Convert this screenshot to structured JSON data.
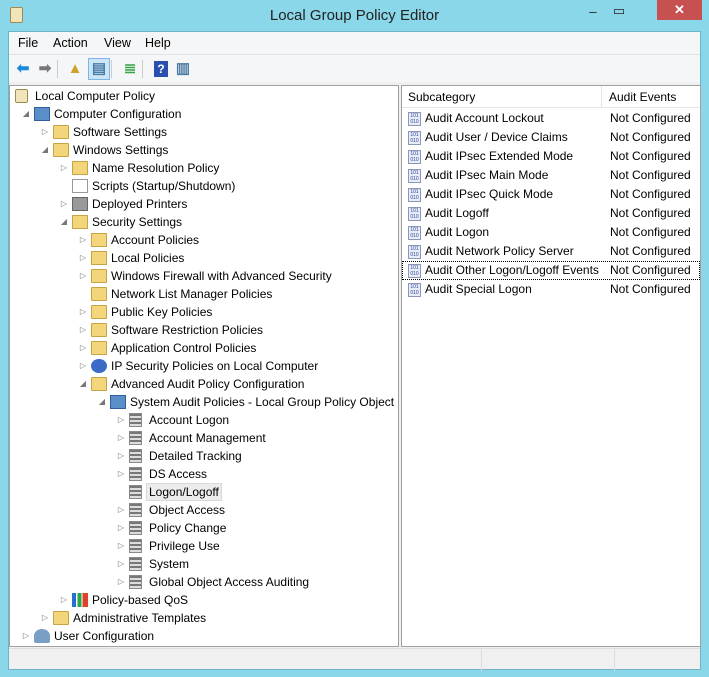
{
  "window": {
    "title": "Local Group Policy Editor",
    "minimize": "–",
    "maximize": "▭",
    "close": "✕"
  },
  "menu": [
    "File",
    "Action",
    "View",
    "Help"
  ],
  "toolbar": [
    {
      "name": "back-button",
      "glyph": "⬅",
      "color": "#1e88d8"
    },
    {
      "name": "forward-button",
      "glyph": "➡",
      "color": "#777"
    },
    {
      "name": "up-folder-button",
      "glyph": "▲",
      "color": "#d1a12d"
    },
    {
      "name": "show-hide-tree-button",
      "glyph": "▤",
      "color": "#4a7ba6",
      "active": true
    },
    {
      "name": "export-list-button",
      "glyph": "≣",
      "color": "#3aa34a"
    },
    {
      "name": "help-button",
      "glyph": "?",
      "color": "#fff",
      "bg": "#2a4fb0"
    },
    {
      "name": "show-hide-action-pane-button",
      "glyph": "▥",
      "color": "#4a7ba6"
    }
  ],
  "tree": [
    {
      "label": "Local Computer Policy",
      "level": 0,
      "exp": "none",
      "icon": "scroll"
    },
    {
      "label": "Computer Configuration",
      "level": 1,
      "exp": "open",
      "icon": "computer"
    },
    {
      "label": "Software Settings",
      "level": 2,
      "exp": "closed",
      "icon": "folder"
    },
    {
      "label": "Windows Settings",
      "level": 2,
      "exp": "open",
      "icon": "folder"
    },
    {
      "label": "Name Resolution Policy",
      "level": 3,
      "exp": "closed",
      "icon": "folder"
    },
    {
      "label": "Scripts (Startup/Shutdown)",
      "level": 3,
      "exp": "none",
      "icon": "script"
    },
    {
      "label": "Deployed Printers",
      "level": 3,
      "exp": "closed",
      "icon": "printer"
    },
    {
      "label": "Security Settings",
      "level": 3,
      "exp": "open",
      "icon": "lock"
    },
    {
      "label": "Account Policies",
      "level": 4,
      "exp": "closed",
      "icon": "lock"
    },
    {
      "label": "Local Policies",
      "level": 4,
      "exp": "closed",
      "icon": "lock"
    },
    {
      "label": "Windows Firewall with Advanced Security",
      "level": 4,
      "exp": "closed",
      "icon": "folder"
    },
    {
      "label": "Network List Manager Policies",
      "level": 4,
      "exp": "none",
      "icon": "folder"
    },
    {
      "label": "Public Key Policies",
      "level": 4,
      "exp": "closed",
      "icon": "folder"
    },
    {
      "label": "Software Restriction Policies",
      "level": 4,
      "exp": "closed",
      "icon": "folder"
    },
    {
      "label": "Application Control Policies",
      "level": 4,
      "exp": "closed",
      "icon": "folder"
    },
    {
      "label": "IP Security Policies on Local Computer",
      "level": 4,
      "exp": "closed",
      "icon": "ipsec"
    },
    {
      "label": "Advanced Audit Policy Configuration",
      "level": 4,
      "exp": "open",
      "icon": "folder"
    },
    {
      "label": "System Audit Policies - Local Group Policy Object",
      "level": 5,
      "exp": "open",
      "icon": "computer"
    },
    {
      "label": "Account Logon",
      "level": 6,
      "exp": "closed",
      "icon": "audit"
    },
    {
      "label": "Account Management",
      "level": 6,
      "exp": "closed",
      "icon": "audit"
    },
    {
      "label": "Detailed Tracking",
      "level": 6,
      "exp": "closed",
      "icon": "audit"
    },
    {
      "label": "DS Access",
      "level": 6,
      "exp": "closed",
      "icon": "audit"
    },
    {
      "label": "Logon/Logoff",
      "level": 6,
      "exp": "none",
      "icon": "audit",
      "selected": true
    },
    {
      "label": "Object Access",
      "level": 6,
      "exp": "closed",
      "icon": "audit"
    },
    {
      "label": "Policy Change",
      "level": 6,
      "exp": "closed",
      "icon": "audit"
    },
    {
      "label": "Privilege Use",
      "level": 6,
      "exp": "closed",
      "icon": "audit"
    },
    {
      "label": "System",
      "level": 6,
      "exp": "closed",
      "icon": "audit"
    },
    {
      "label": "Global Object Access Auditing",
      "level": 6,
      "exp": "closed",
      "icon": "audit"
    },
    {
      "label": "Policy-based QoS",
      "level": 3,
      "exp": "closed",
      "icon": "qos"
    },
    {
      "label": "Administrative Templates",
      "level": 2,
      "exp": "closed",
      "icon": "folder"
    },
    {
      "label": "User Configuration",
      "level": 1,
      "exp": "closed",
      "icon": "user"
    }
  ],
  "list": {
    "columns": [
      "Subcategory",
      "Audit Events"
    ],
    "rows": [
      {
        "name": "Audit Account Lockout",
        "value": "Not Configured"
      },
      {
        "name": "Audit User / Device Claims",
        "value": "Not Configured"
      },
      {
        "name": "Audit IPsec Extended Mode",
        "value": "Not Configured"
      },
      {
        "name": "Audit IPsec Main Mode",
        "value": "Not Configured"
      },
      {
        "name": "Audit IPsec Quick Mode",
        "value": "Not Configured"
      },
      {
        "name": "Audit Logoff",
        "value": "Not Configured"
      },
      {
        "name": "Audit Logon",
        "value": "Not Configured"
      },
      {
        "name": "Audit Network Policy Server",
        "value": "Not Configured"
      },
      {
        "name": "Audit Other Logon/Logoff Events",
        "value": "Not Configured",
        "focused": true
      },
      {
        "name": "Audit Special Logon",
        "value": "Not Configured"
      }
    ]
  }
}
